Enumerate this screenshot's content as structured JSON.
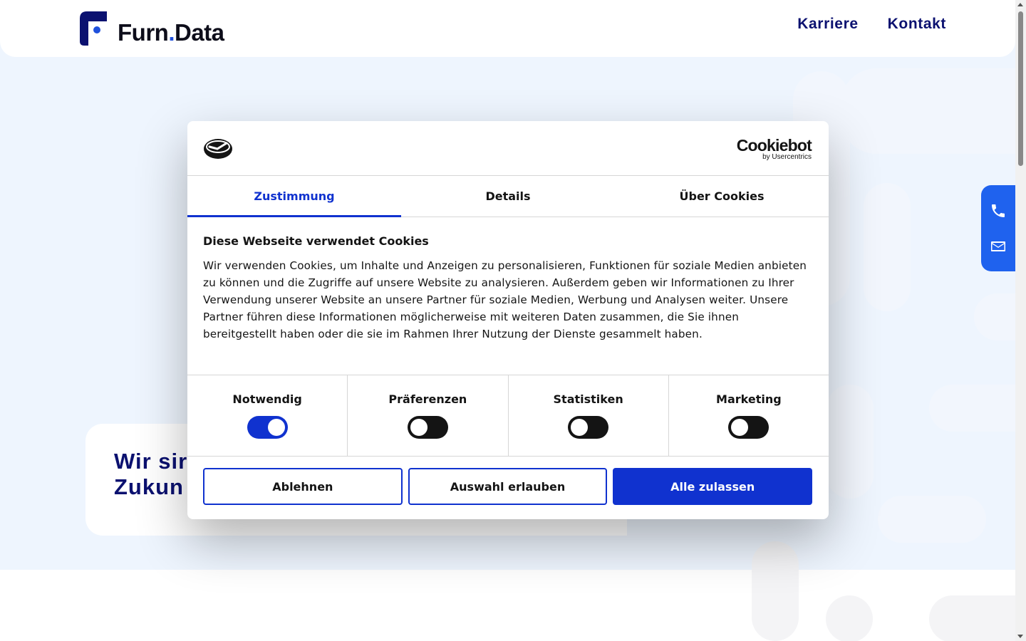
{
  "header": {
    "logo_text_part1": "Furn",
    "logo_dot": ".",
    "logo_text_part2": "Data",
    "nav": [
      {
        "label": "Karriere"
      },
      {
        "label": "Kontakt"
      }
    ]
  },
  "hero": {
    "title": "Wir sir\nZukun"
  },
  "side_contact": {
    "icons": [
      "phone-icon",
      "mail-icon"
    ]
  },
  "cookie_dialog": {
    "brand": "Cookiebot",
    "brand_sub": "by Usercentrics",
    "tabs": [
      {
        "label": "Zustimmung",
        "active": true
      },
      {
        "label": "Details",
        "active": false
      },
      {
        "label": "Über Cookies",
        "active": false
      }
    ],
    "title": "Diese Webseite verwendet Cookies",
    "text": "Wir verwenden Cookies, um Inhalte und Anzeigen zu personalisieren, Funktionen für soziale Medien anbieten zu können und die Zugriffe auf unsere Website zu analysieren. Außerdem geben wir Informationen zu Ihrer Verwendung unserer Website an unsere Partner für soziale Medien, Werbung und Analysen weiter. Unsere Partner führen diese Informationen möglicherweise mit weiteren Daten zusammen, die Sie ihnen bereitgestellt haben oder die sie im Rahmen Ihrer Nutzung der Dienste gesammelt haben.",
    "toggles": [
      {
        "label": "Notwendig",
        "on": true
      },
      {
        "label": "Präferenzen",
        "on": false
      },
      {
        "label": "Statistiken",
        "on": false
      },
      {
        "label": "Marketing",
        "on": false
      }
    ],
    "buttons": {
      "decline": "Ablehnen",
      "allow_selection": "Auswahl erlauben",
      "allow_all": "Alle zulassen"
    }
  },
  "colors": {
    "primary": "#1032cf",
    "nav_text": "#0b1170",
    "side_bar": "#1f62ee",
    "hero_bg": "#eef5fe"
  }
}
